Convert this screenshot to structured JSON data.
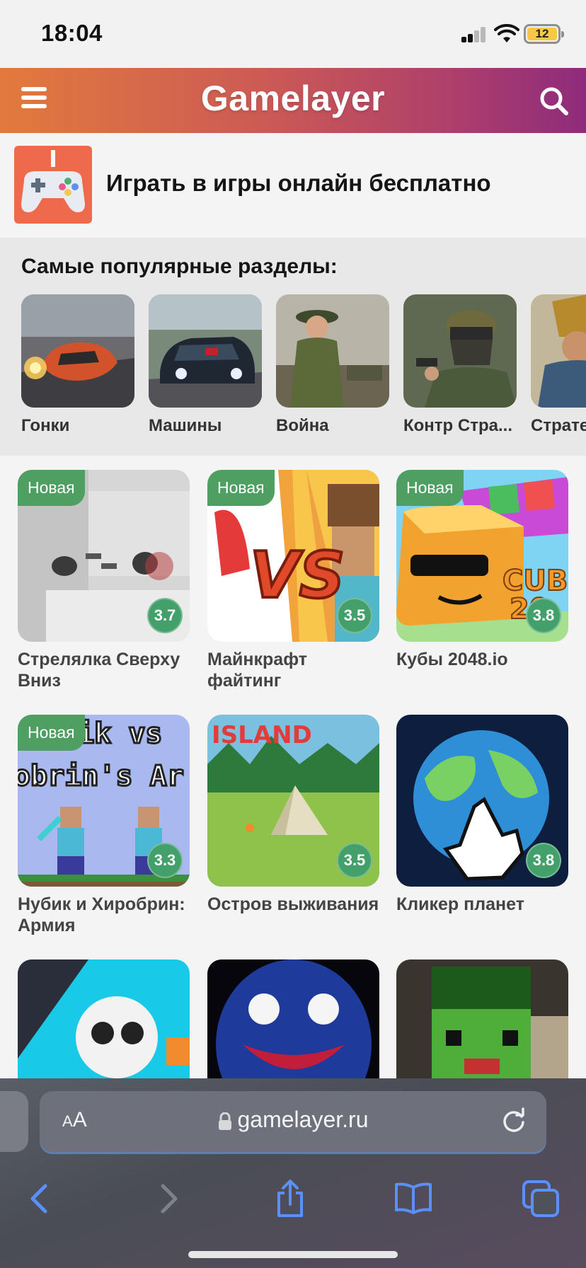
{
  "status_bar": {
    "time": "18:04",
    "battery": "12"
  },
  "header": {
    "logo": "Gamelayer",
    "menu_icon": "hamburger-menu-icon",
    "search_icon": "search-icon"
  },
  "intro": {
    "title": "Играть в игры онлайн бесплатно",
    "icon": "gamepad-icon"
  },
  "popular": {
    "title": "Самые популярные разделы:",
    "categories": [
      {
        "label": "Гонки"
      },
      {
        "label": "Машины"
      },
      {
        "label": "Война"
      },
      {
        "label": "Контр Стра..."
      },
      {
        "label": "Страте"
      }
    ]
  },
  "games": [
    {
      "title": "Стрелялка Сверху Вниз",
      "rating": "3.7",
      "badge": "Новая"
    },
    {
      "title": "Майнкрафт файтинг",
      "rating": "3.5",
      "badge": "Новая"
    },
    {
      "title": "Кубы 2048.io",
      "rating": "3.8",
      "badge": "Новая"
    },
    {
      "title": "Нубик и Хиробрин: Армия",
      "rating": "3.3",
      "badge": "Новая"
    },
    {
      "title": "Остров выживания",
      "rating": "3.5",
      "badge": ""
    },
    {
      "title": "Кликер планет",
      "rating": "3.8",
      "badge": ""
    },
    {
      "title": "",
      "rating": "",
      "badge": ""
    },
    {
      "title": "",
      "rating": "",
      "badge": ""
    },
    {
      "title": "",
      "rating": "",
      "badge": ""
    }
  ],
  "browser": {
    "text_size_label": "AA",
    "url": "gamelayer.ru"
  },
  "colors": {
    "header_start": "#e27a3d",
    "header_end": "#8e2b7c",
    "badge_green": "#4f9f63",
    "rating_green": "#43a06a",
    "safari_blue": "#5b8ff9"
  }
}
